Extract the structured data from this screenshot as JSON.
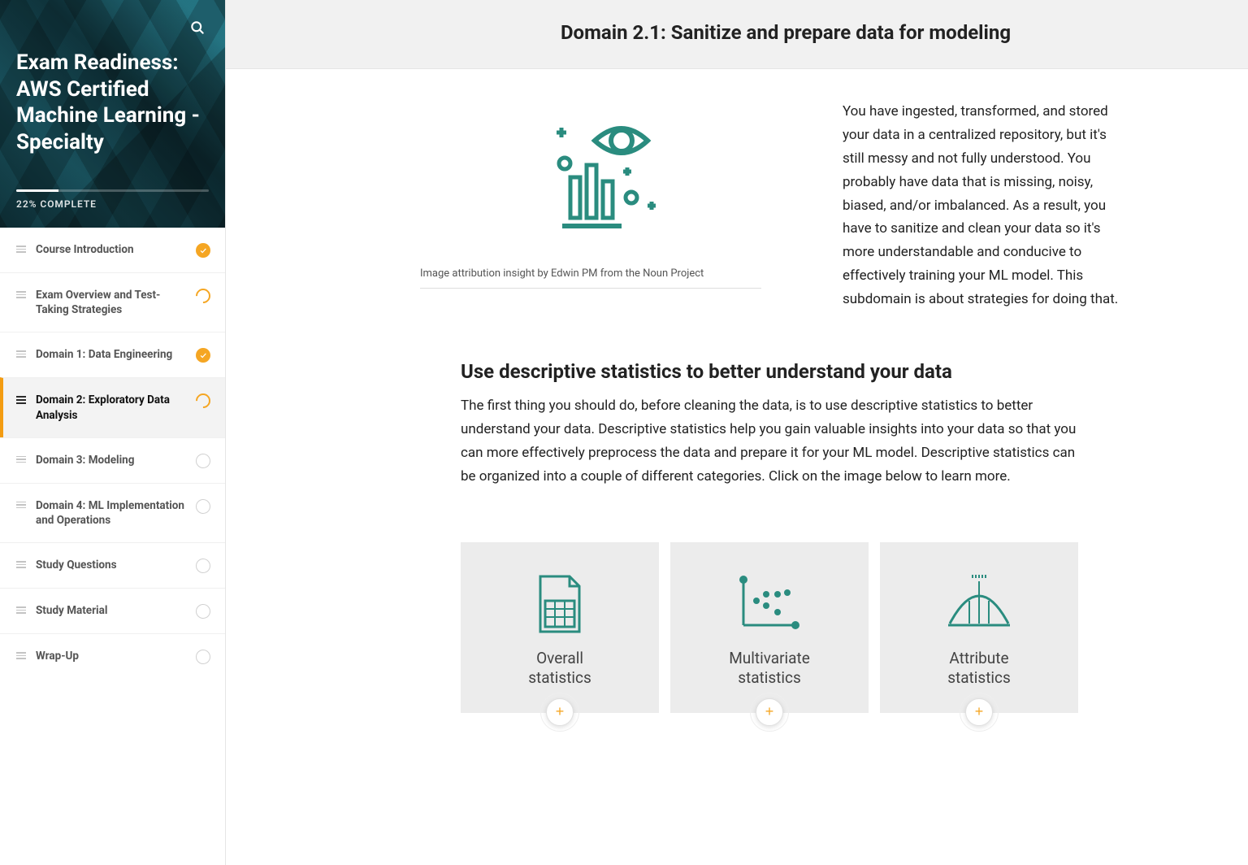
{
  "sidebar": {
    "course_title": "Exam Readiness: AWS Certified Machine Learning - Specialty",
    "progress_text": "22% COMPLETE",
    "progress_pct": 22,
    "items": [
      {
        "label": "Course Introduction",
        "status": "done"
      },
      {
        "label": "Exam Overview and Test-Taking Strategies",
        "status": "partial"
      },
      {
        "label": "Domain 1: Data Engineering",
        "status": "done"
      },
      {
        "label": "Domain 2: Exploratory Data Analysis",
        "status": "partial",
        "active": true
      },
      {
        "label": "Domain 3: Modeling",
        "status": "empty"
      },
      {
        "label": "Domain 4: ML Implementation and Operations",
        "status": "empty"
      },
      {
        "label": "Study Questions",
        "status": "empty"
      },
      {
        "label": "Study Material",
        "status": "empty"
      },
      {
        "label": "Wrap-Up",
        "status": "empty"
      }
    ]
  },
  "page": {
    "title": "Domain 2.1: Sanitize and prepare data for modeling",
    "intro_caption": "Image attribution insight by Edwin PM from the Noun Project",
    "intro_text": "You have ingested, transformed, and stored your data in a centralized repository, but it's still messy and not fully understood. You probably have data that is missing, noisy, biased, and/or imbalanced. As a result, you have to sanitize and clean your data so it's more understandable and conducive to effectively training your ML model. This subdomain is about strategies for doing that.",
    "subheading": "Use descriptive statistics to better understand your data",
    "subtext": "The first thing you should do, before cleaning the data, is to use descriptive statistics to better understand your data. Descriptive statistics help you gain valuable insights into your data so that you can more effectively preprocess the data and prepare it for your ML model. Descriptive statistics can be organized into a couple of different categories. Click on the image below to learn more.",
    "cards": [
      {
        "label": "Overall\nstatistics"
      },
      {
        "label": "Multivariate\nstatistics"
      },
      {
        "label": "Attribute\nstatistics"
      }
    ]
  },
  "colors": {
    "accent": "#f5a623",
    "teal": "#2a8c7f"
  }
}
